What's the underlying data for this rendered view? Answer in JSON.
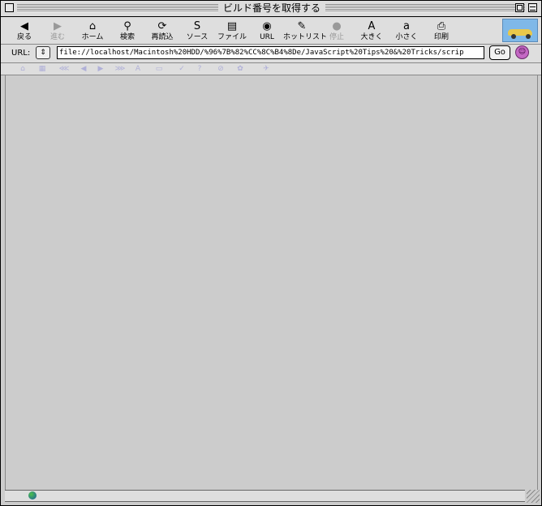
{
  "window": {
    "title": "ビルド番号を取得する"
  },
  "toolbar": {
    "items": [
      {
        "label": "戻る",
        "icon": "back-arrow-icon",
        "glyph": "◀",
        "disabled": false
      },
      {
        "label": "進む",
        "icon": "forward-arrow-icon",
        "glyph": "▶",
        "disabled": true
      },
      {
        "label": "ホーム",
        "icon": "home-icon",
        "glyph": "⌂",
        "disabled": false
      },
      {
        "label": "検索",
        "icon": "search-icon",
        "glyph": "⚲",
        "disabled": false
      },
      {
        "label": "再読込",
        "icon": "reload-icon",
        "glyph": "⟳",
        "disabled": false
      },
      {
        "label": "ソース",
        "icon": "source-icon",
        "glyph": "S",
        "disabled": false
      },
      {
        "label": "ファイル",
        "icon": "file-icon",
        "glyph": "▤",
        "disabled": false
      },
      {
        "label": "URL",
        "icon": "url-globe-icon",
        "glyph": "◉",
        "disabled": false
      },
      {
        "label": "ホットリスト",
        "icon": "hotlist-icon",
        "glyph": "✎",
        "disabled": false
      },
      {
        "label": "停止",
        "icon": "stop-icon",
        "glyph": "●",
        "disabled": true
      },
      {
        "label": "大きく",
        "icon": "larger-text-icon",
        "glyph": "A",
        "disabled": false
      },
      {
        "label": "小さく",
        "icon": "smaller-text-icon",
        "glyph": "a",
        "disabled": false
      },
      {
        "label": "印刷",
        "icon": "print-icon",
        "glyph": "⎙",
        "disabled": false
      }
    ]
  },
  "urlbar": {
    "label": "URL:",
    "value": "file://localhost/Macintosh%20HDD/%96%7B%82%CC%8C%B4%8De/JavaScript%20Tips%20&%20Tricks/scrip",
    "go_label": "Go"
  },
  "navbar": {
    "icons": [
      "home-nav-icon",
      "grid-icon",
      "first-icon",
      "prev-icon",
      "next-icon",
      "last-icon",
      "text-icon",
      "doc-icon",
      "check-icon",
      "help-icon",
      "link-icon",
      "settings-icon",
      "send-icon"
    ]
  }
}
